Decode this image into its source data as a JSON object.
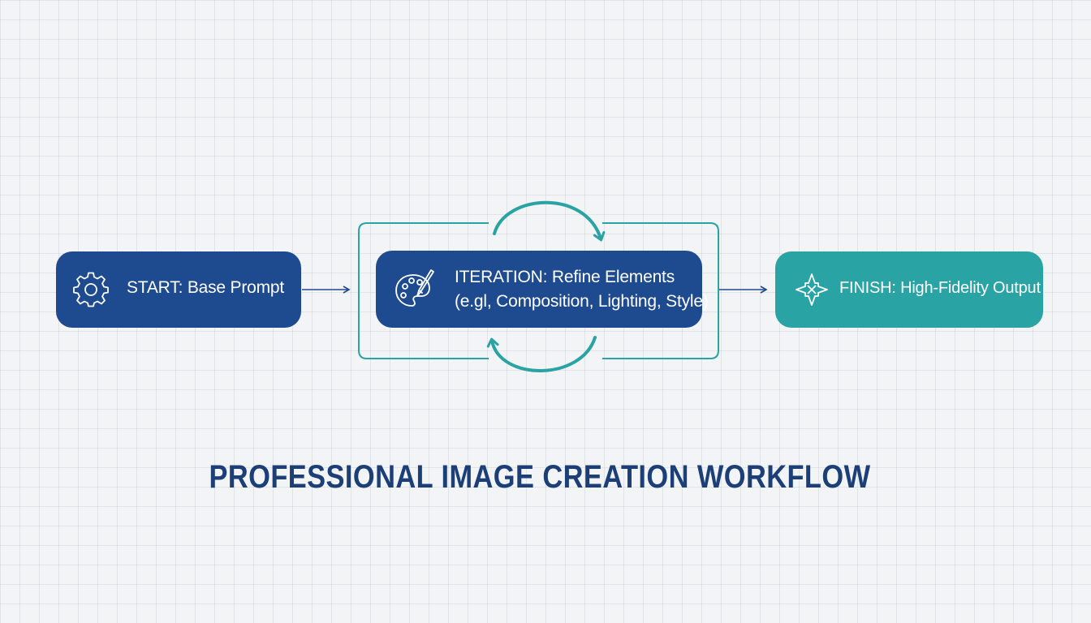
{
  "diagram": {
    "title": "PROFESSIONAL IMAGE CREATION WORKFLOW",
    "nodes": {
      "start": {
        "label": "START: Base Prompt",
        "icon": "gear-icon",
        "color": "#1e4b8f"
      },
      "iteration": {
        "label_line1": "ITERATION: Refine Elements",
        "label_line2": "(e.gl, Composition, Lighting, Style)",
        "icon": "palette-brush-icon",
        "color": "#1e4b8f"
      },
      "finish": {
        "label": "FINISH: High-Fidelity Output",
        "icon": "sparkle-diamond-icon",
        "color": "#2aa3a4"
      }
    },
    "colors": {
      "loop": "#2aa3a4",
      "arrow": "#1e4b8f",
      "title": "#1c3f78"
    }
  }
}
